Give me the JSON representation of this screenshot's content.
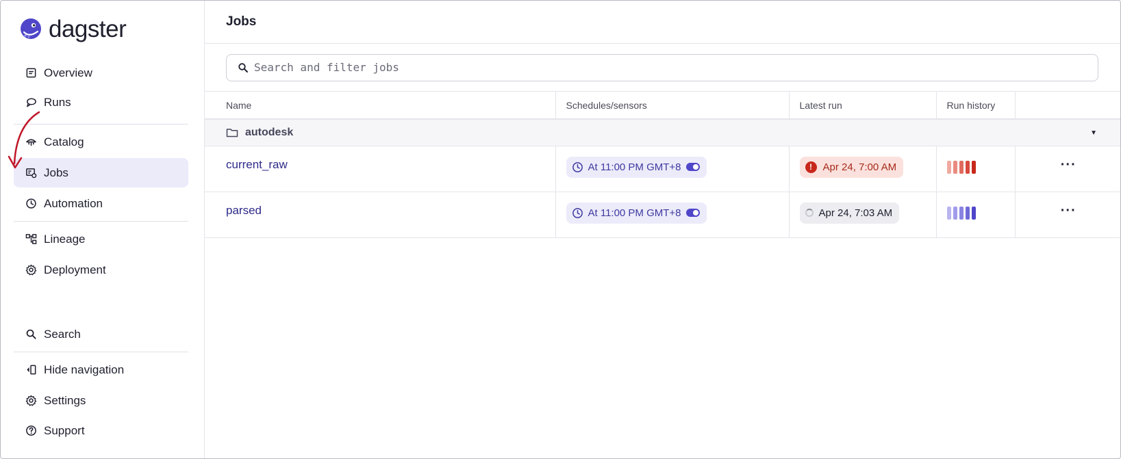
{
  "app": {
    "logo_text": "dagster"
  },
  "sidebar": {
    "items": [
      {
        "label": "Overview",
        "icon": "overview-icon"
      },
      {
        "label": "Runs",
        "icon": "runs-icon"
      },
      {
        "label": "Catalog",
        "icon": "catalog-icon"
      },
      {
        "label": "Jobs",
        "icon": "jobs-icon",
        "active": true
      },
      {
        "label": "Automation",
        "icon": "automation-icon"
      },
      {
        "label": "Lineage",
        "icon": "lineage-icon"
      },
      {
        "label": "Deployment",
        "icon": "gear-icon"
      }
    ],
    "footer": [
      {
        "label": "Search",
        "icon": "search-icon"
      },
      {
        "label": "Hide navigation",
        "icon": "hide-navigation-icon"
      },
      {
        "label": "Settings",
        "icon": "gear-icon"
      },
      {
        "label": "Support",
        "icon": "help-icon"
      }
    ]
  },
  "header": {
    "title": "Jobs"
  },
  "search": {
    "placeholder": "Search and filter jobs"
  },
  "table": {
    "columns": [
      "Name",
      "Schedules/sensors",
      "Latest run",
      "Run history"
    ],
    "group": {
      "name": "autodesk"
    },
    "rows": [
      {
        "name": "current_raw",
        "schedule": "At 11:00 PM GMT+8",
        "schedule_enabled": true,
        "latest_run": "Apr 24, 7:00 AM",
        "latest_status": "failure",
        "history_colors": [
          "#f0a9a0",
          "#e98b80",
          "#e06b5e",
          "#d84a3d",
          "#c7281b"
        ]
      },
      {
        "name": "parsed",
        "schedule": "At 11:00 PM GMT+8",
        "schedule_enabled": true,
        "latest_run": "Apr 24, 7:03 AM",
        "latest_status": "running",
        "history_colors": [
          "#b9b5f0",
          "#a19cea",
          "#8983e2",
          "#6f69d8",
          "#4f46c9"
        ]
      }
    ]
  },
  "colors": {
    "accent": "#4f46c9",
    "active_bg": "#ecebfa",
    "failure": "#c7281b"
  }
}
